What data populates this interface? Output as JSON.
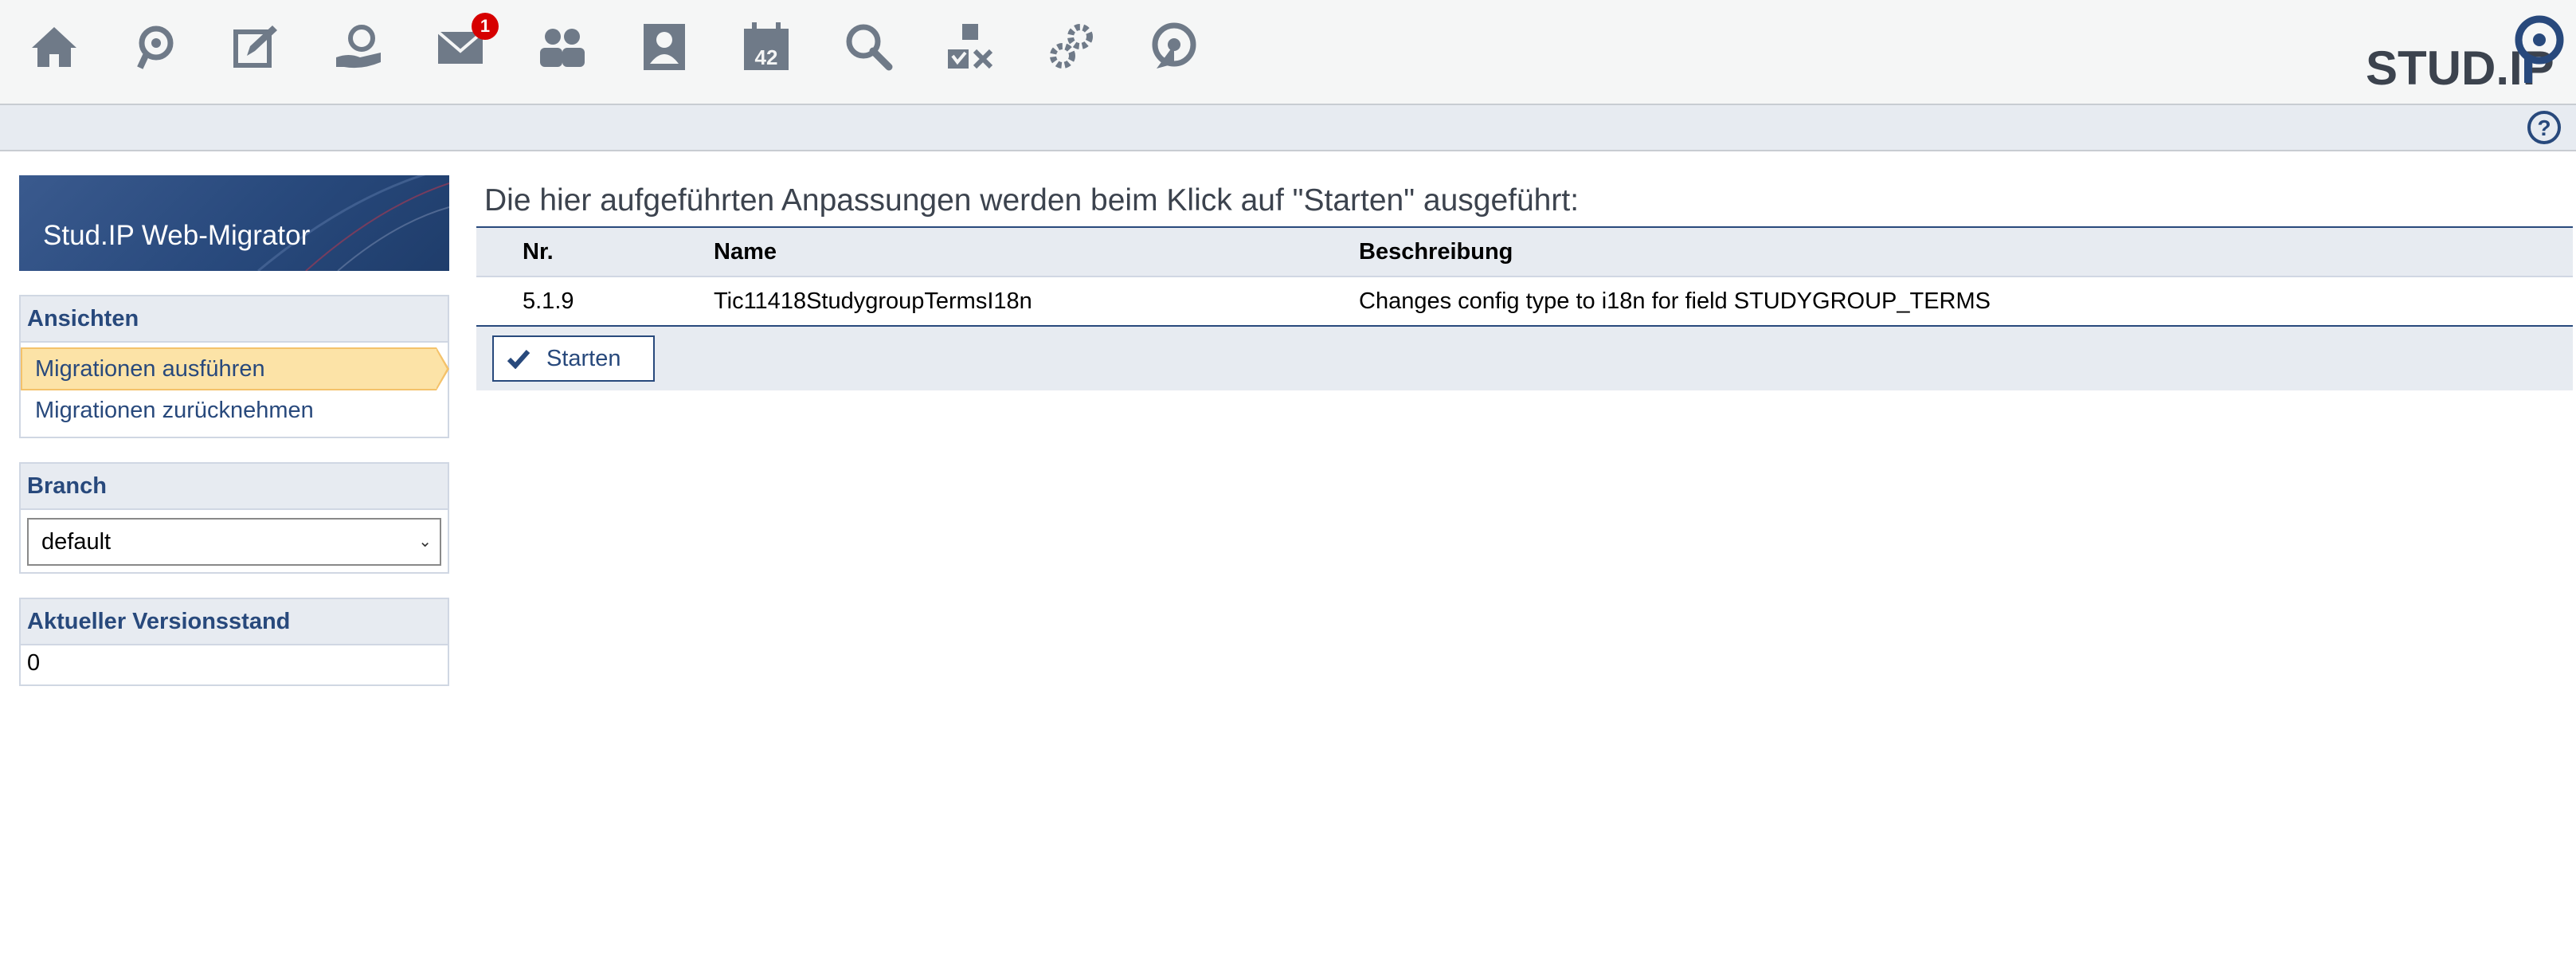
{
  "topbar": {
    "icons": [
      {
        "name": "home-icon"
      },
      {
        "name": "courses-icon"
      },
      {
        "name": "workplace-icon"
      },
      {
        "name": "community-icon"
      },
      {
        "name": "messages-icon",
        "badge": "1"
      },
      {
        "name": "contacts-icon"
      },
      {
        "name": "profile-icon"
      },
      {
        "name": "schedule-icon",
        "text": "42"
      },
      {
        "name": "search-icon"
      },
      {
        "name": "tools-icon"
      },
      {
        "name": "admin-icon"
      },
      {
        "name": "migration-icon"
      }
    ],
    "logo_text": "STUD.IP"
  },
  "sidebar": {
    "title": "Stud.IP Web-Migrator",
    "views": {
      "header": "Ansichten",
      "items": [
        {
          "label": "Migrationen ausführen",
          "active": true
        },
        {
          "label": "Migrationen zurücknehmen",
          "active": false
        }
      ]
    },
    "branch": {
      "header": "Branch",
      "selected": "default"
    },
    "version": {
      "header": "Aktueller Versionsstand",
      "value": "0"
    }
  },
  "main": {
    "title": "Die hier aufgeführten Anpassungen werden beim Klick auf \"Starten\" ausgeführt:",
    "table": {
      "columns": [
        "Nr.",
        "Name",
        "Beschreibung"
      ],
      "rows": [
        {
          "nr": "5.1.9",
          "name": "Tic11418StudygroupTermsI18n",
          "description": "Changes config type to i18n for field STUDYGROUP_TERMS"
        }
      ]
    },
    "start_label": "Starten"
  },
  "colors": {
    "brand": "#28497c",
    "active_nav": "#fce3a7",
    "badge": "#d60000",
    "icon": "#6f7a88"
  }
}
